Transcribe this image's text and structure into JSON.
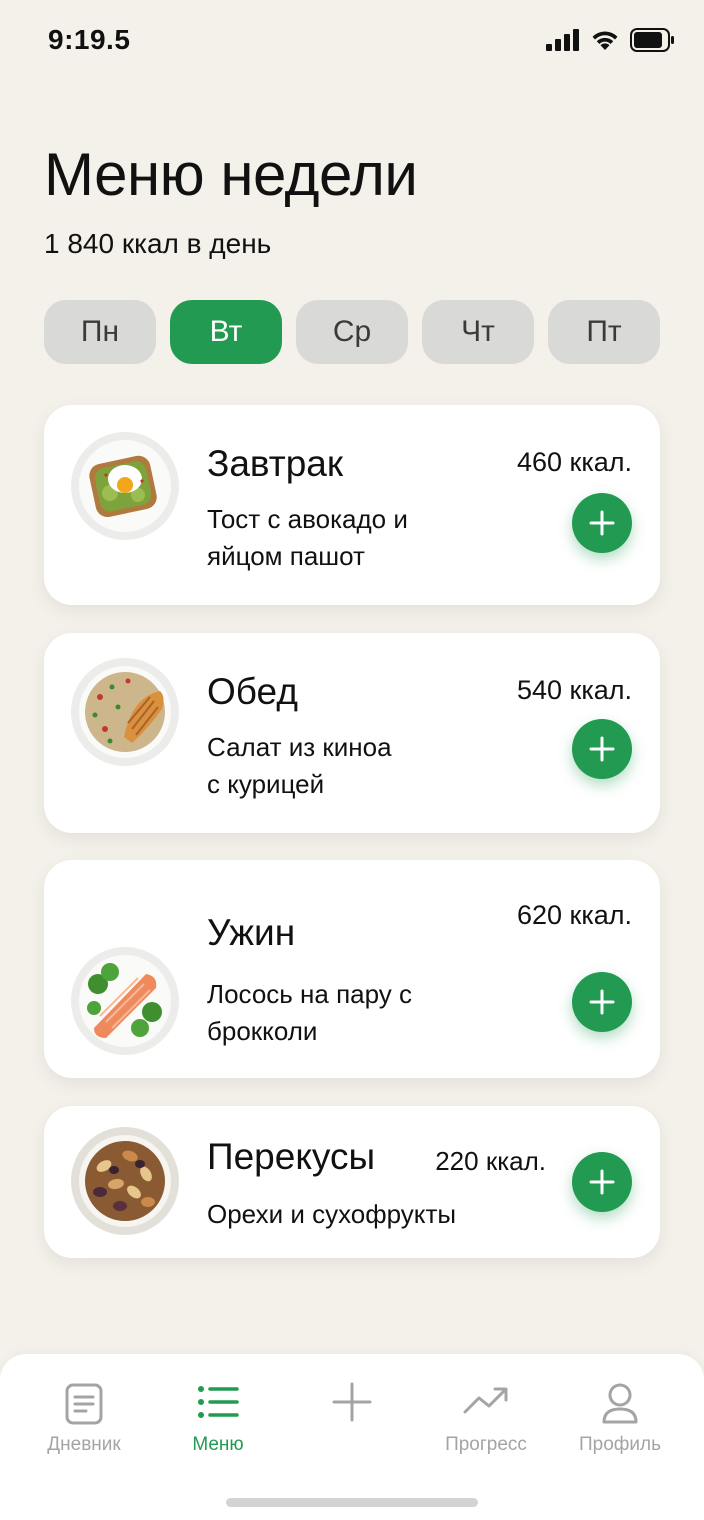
{
  "status_bar": {
    "time": "9:19.5"
  },
  "header": {
    "title": "Меню недели",
    "subtitle": "1 840 ккал в день"
  },
  "day_tabs": [
    {
      "label": "Пн",
      "active": false
    },
    {
      "label": "Вт",
      "active": true
    },
    {
      "label": "Ср",
      "active": false
    },
    {
      "label": "Чт",
      "active": false
    },
    {
      "label": "Пт",
      "active": false
    }
  ],
  "meals": [
    {
      "name": "Завтрак",
      "kcal": "460 ккал.",
      "desc_line1": "Тост с авокадо и",
      "desc_line2": "яйцом пашот",
      "image": "avocado-toast-plate"
    },
    {
      "name": "Обед",
      "kcal": "540 ккал.",
      "desc_line1": "Салат из киноа",
      "desc_line2": "с курицей",
      "image": "quinoa-chicken-plate"
    },
    {
      "name": "Ужин",
      "kcal": "620 ккал.",
      "desc_line1": "Лосось на пару с",
      "desc_line2": "брокколи",
      "image": "salmon-broccoli-plate"
    },
    {
      "name": "Перекусы",
      "kcal": "220 ккал.",
      "desc_line1": "Орехи и сухофрукты",
      "desc_line2": "",
      "image": "nuts-bowl"
    }
  ],
  "tab_bar": {
    "items": [
      {
        "label": "Дневник",
        "icon": "diary-icon",
        "active": false
      },
      {
        "label": "Меню",
        "icon": "menu-list-icon",
        "active": true
      },
      {
        "label": "",
        "icon": "plus-icon",
        "active": false
      },
      {
        "label": "Прогресс",
        "icon": "trend-icon",
        "active": false
      },
      {
        "label": "Профиль",
        "icon": "profile-icon",
        "active": false
      }
    ]
  },
  "colors": {
    "accent": "#239a52",
    "background": "#f4f1ea",
    "inactive_tab": "#d9d9d7"
  }
}
